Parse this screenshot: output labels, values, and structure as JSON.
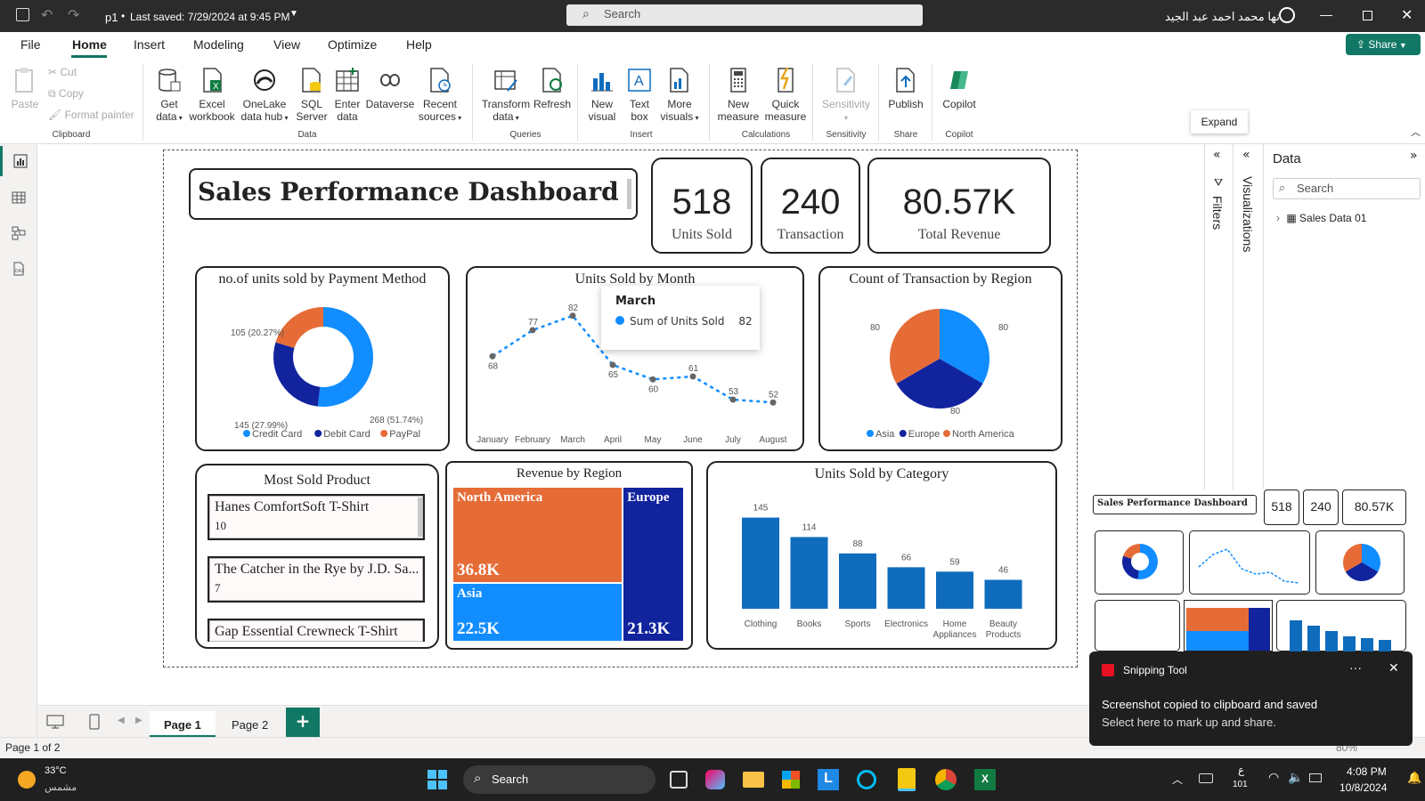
{
  "titlebar": {
    "doc_title": "p1",
    "saved": "Last saved: 7/29/2024 at 9:45 PM",
    "search_placeholder": "Search",
    "user": "نها محمد احمد عبد الجيد"
  },
  "menu": [
    "File",
    "Home",
    "Insert",
    "Modeling",
    "View",
    "Optimize",
    "Help"
  ],
  "share_label": "Share",
  "ribbon": {
    "paste": "Paste",
    "cut": "Cut",
    "copy": "Copy",
    "format_painter": "Format painter",
    "get_data": [
      "Get",
      "data"
    ],
    "excel": [
      "Excel",
      "workbook"
    ],
    "onelake": [
      "OneLake",
      "data hub"
    ],
    "sql": [
      "SQL",
      "Server"
    ],
    "enter": [
      "Enter",
      "data"
    ],
    "dataverse": "Dataverse",
    "recent": [
      "Recent",
      "sources"
    ],
    "transform": [
      "Transform",
      "data"
    ],
    "refresh": "Refresh",
    "new_visual": [
      "New",
      "visual"
    ],
    "text_box": [
      "Text",
      "box"
    ],
    "more_visuals": [
      "More",
      "visuals"
    ],
    "new_measure": [
      "New",
      "measure"
    ],
    "quick_measure": [
      "Quick",
      "measure"
    ],
    "sensitivity": "Sensitivity",
    "publish": "Publish",
    "copilot": "Copilot",
    "groups": {
      "clipboard": "Clipboard",
      "data": "Data",
      "queries": "Queries",
      "insert": "Insert",
      "calculations": "Calculations",
      "sensitivity": "Sensitivity",
      "share": "Share",
      "copilot": "Copilot"
    }
  },
  "tooltip_expand": "Expand",
  "dashboard": {
    "title": "Sales Performance Dashboard",
    "kpis": [
      {
        "value": "518",
        "label": "Units Sold"
      },
      {
        "value": "240",
        "label": "Transaction"
      },
      {
        "value": "80.57K",
        "label": "Total Revenue"
      }
    ],
    "most_sold": {
      "title": "Most Sold Product",
      "items": [
        {
          "name": "Hanes ComfortSoft T-Shirt",
          "value": "10"
        },
        {
          "name": "The Catcher in the Rye by J.D. Sa...",
          "value": "7"
        },
        {
          "name": "Gap Essential Crewneck T-Shirt",
          "value": ""
        }
      ]
    }
  },
  "chart_data": [
    {
      "type": "pie",
      "title": "no.of units sold by Payment Method",
      "donut": true,
      "categories": [
        "Credit Card",
        "Debit Card",
        "PayPal"
      ],
      "values": [
        268,
        145,
        105
      ],
      "labels": [
        "268 (51.74%)",
        "145 (27.99%)",
        "105 (20.27%)"
      ],
      "colors": [
        "#118dff",
        "#12239e",
        "#e66c37"
      ],
      "legend": "bottom"
    },
    {
      "type": "line",
      "title": "Units Sold by Month",
      "categories": [
        "January",
        "February",
        "March",
        "April",
        "May",
        "June",
        "July",
        "August"
      ],
      "values": [
        68,
        77,
        82,
        65,
        60,
        61,
        53,
        52
      ],
      "ylim": [
        45,
        85
      ],
      "color": "#118dff",
      "tooltip": {
        "title": "March",
        "series": "Sum of Units Sold",
        "value": "82"
      }
    },
    {
      "type": "pie",
      "title": "Count of Transaction by Region",
      "categories": [
        "Asia",
        "Europe",
        "North America"
      ],
      "values": [
        80,
        80,
        80
      ],
      "labels": [
        "80",
        "80",
        "80"
      ],
      "colors": [
        "#118dff",
        "#12239e",
        "#e66c37"
      ],
      "legend": "bottom"
    },
    {
      "type": "treemap",
      "title": "Revenue by Region",
      "categories": [
        "North America",
        "Asia",
        "Europe"
      ],
      "values": [
        36.8,
        22.5,
        21.3
      ],
      "labels": [
        "36.8K",
        "22.5K",
        "21.3K"
      ],
      "colors": [
        "#e66c37",
        "#118dff",
        "#12239e"
      ]
    },
    {
      "type": "bar",
      "title": "Units Sold by Category",
      "categories": [
        "Clothing",
        "Books",
        "Sports",
        "Electronics",
        "Home Appliances",
        "Beauty Products"
      ],
      "tick_lines": [
        [
          "Clothing"
        ],
        [
          "Books"
        ],
        [
          "Sports"
        ],
        [
          "Electronics"
        ],
        [
          "Home",
          "Appliances"
        ],
        [
          "Beauty",
          "Products"
        ]
      ],
      "values": [
        145,
        114,
        88,
        66,
        59,
        46
      ],
      "ylim": [
        0,
        150
      ],
      "color": "#0f6cbd"
    }
  ],
  "thumbnail": {
    "title": "Sales Performance Dashboard",
    "kpi_values": [
      "518",
      "240",
      "80.57K"
    ]
  },
  "panes": {
    "filters": "Filters",
    "visualizations": "Visualizations",
    "data_title": "Data",
    "search_placeholder": "Search",
    "table": "Sales Data 01"
  },
  "pages": {
    "page1": "Page 1",
    "page2": "Page 2",
    "add": "+"
  },
  "status": {
    "page_info": "Page 1 of 2",
    "zoom": "80%"
  },
  "toast": {
    "app": "Snipping Tool",
    "line1": "Screenshot copied to clipboard and saved",
    "line2": "Select here to mark up and share."
  },
  "taskbar": {
    "temp": "33°C",
    "weather": "مشمس",
    "search": "Search",
    "time": "4:08 PM",
    "date": "10/8/2024",
    "lang": "ع",
    "lang_sub": "101"
  }
}
